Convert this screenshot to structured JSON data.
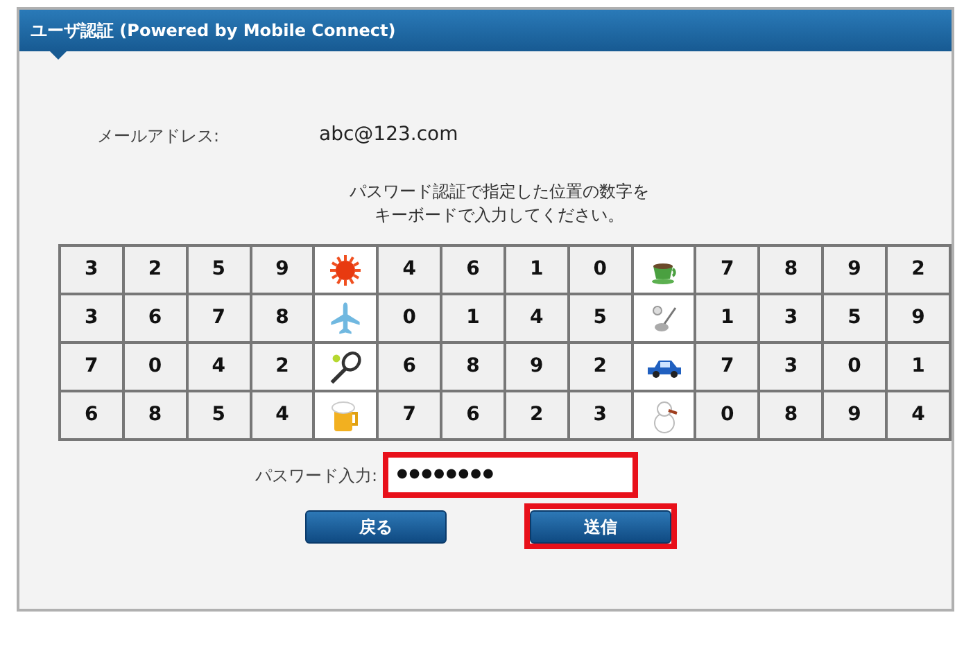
{
  "window": {
    "title": "ユーザ認証 (Powered by Mobile Connect)"
  },
  "email": {
    "label": "メールアドレス:",
    "value": "abc@123.com"
  },
  "instruction": [
    "パスワード認証で指定した位置の数字を",
    "キーボードで入力してください。"
  ],
  "grid": [
    [
      {
        "kind": "digit",
        "text": "3"
      },
      {
        "kind": "digit",
        "text": "2"
      },
      {
        "kind": "digit",
        "text": "5"
      },
      {
        "kind": "digit",
        "text": "9"
      },
      {
        "kind": "icon"
      },
      {
        "kind": "digit",
        "text": "4"
      },
      {
        "kind": "digit",
        "text": "6"
      },
      {
        "kind": "digit",
        "text": "1"
      },
      {
        "kind": "digit",
        "text": "0"
      },
      {
        "kind": "icon"
      },
      {
        "kind": "digit",
        "text": "7"
      },
      {
        "kind": "digit",
        "text": "8"
      },
      {
        "kind": "digit",
        "text": "9"
      },
      {
        "kind": "digit",
        "text": "2"
      }
    ],
    [
      {
        "kind": "digit",
        "text": "3"
      },
      {
        "kind": "digit",
        "text": "6"
      },
      {
        "kind": "digit",
        "text": "7"
      },
      {
        "kind": "digit",
        "text": "8"
      },
      {
        "kind": "icon"
      },
      {
        "kind": "digit",
        "text": "0"
      },
      {
        "kind": "digit",
        "text": "1"
      },
      {
        "kind": "digit",
        "text": "4"
      },
      {
        "kind": "digit",
        "text": "5"
      },
      {
        "kind": "icon"
      },
      {
        "kind": "digit",
        "text": "1"
      },
      {
        "kind": "digit",
        "text": "3"
      },
      {
        "kind": "digit",
        "text": "5"
      },
      {
        "kind": "digit",
        "text": "9"
      }
    ],
    [
      {
        "kind": "digit",
        "text": "7"
      },
      {
        "kind": "digit",
        "text": "0"
      },
      {
        "kind": "digit",
        "text": "4"
      },
      {
        "kind": "digit",
        "text": "2"
      },
      {
        "kind": "icon"
      },
      {
        "kind": "digit",
        "text": "6"
      },
      {
        "kind": "digit",
        "text": "8"
      },
      {
        "kind": "digit",
        "text": "9"
      },
      {
        "kind": "digit",
        "text": "2"
      },
      {
        "kind": "icon"
      },
      {
        "kind": "digit",
        "text": "7"
      },
      {
        "kind": "digit",
        "text": "3"
      },
      {
        "kind": "digit",
        "text": "0"
      },
      {
        "kind": "digit",
        "text": "1"
      }
    ],
    [
      {
        "kind": "digit",
        "text": "6"
      },
      {
        "kind": "digit",
        "text": "8"
      },
      {
        "kind": "digit",
        "text": "5"
      },
      {
        "kind": "digit",
        "text": "4"
      },
      {
        "kind": "icon"
      },
      {
        "kind": "digit",
        "text": "7"
      },
      {
        "kind": "digit",
        "text": "6"
      },
      {
        "kind": "digit",
        "text": "2"
      },
      {
        "kind": "digit",
        "text": "3"
      },
      {
        "kind": "icon"
      },
      {
        "kind": "digit",
        "text": "0"
      },
      {
        "kind": "digit",
        "text": "8"
      },
      {
        "kind": "digit",
        "text": "9"
      },
      {
        "kind": "digit",
        "text": "4"
      }
    ]
  ],
  "password": {
    "label": "パスワード入力:",
    "value": "●●●●●●●●",
    "highlighted": true
  },
  "buttons": [
    {
      "label": "戻る",
      "highlighted": false
    },
    {
      "label": "送信",
      "highlighted": true
    }
  ]
}
